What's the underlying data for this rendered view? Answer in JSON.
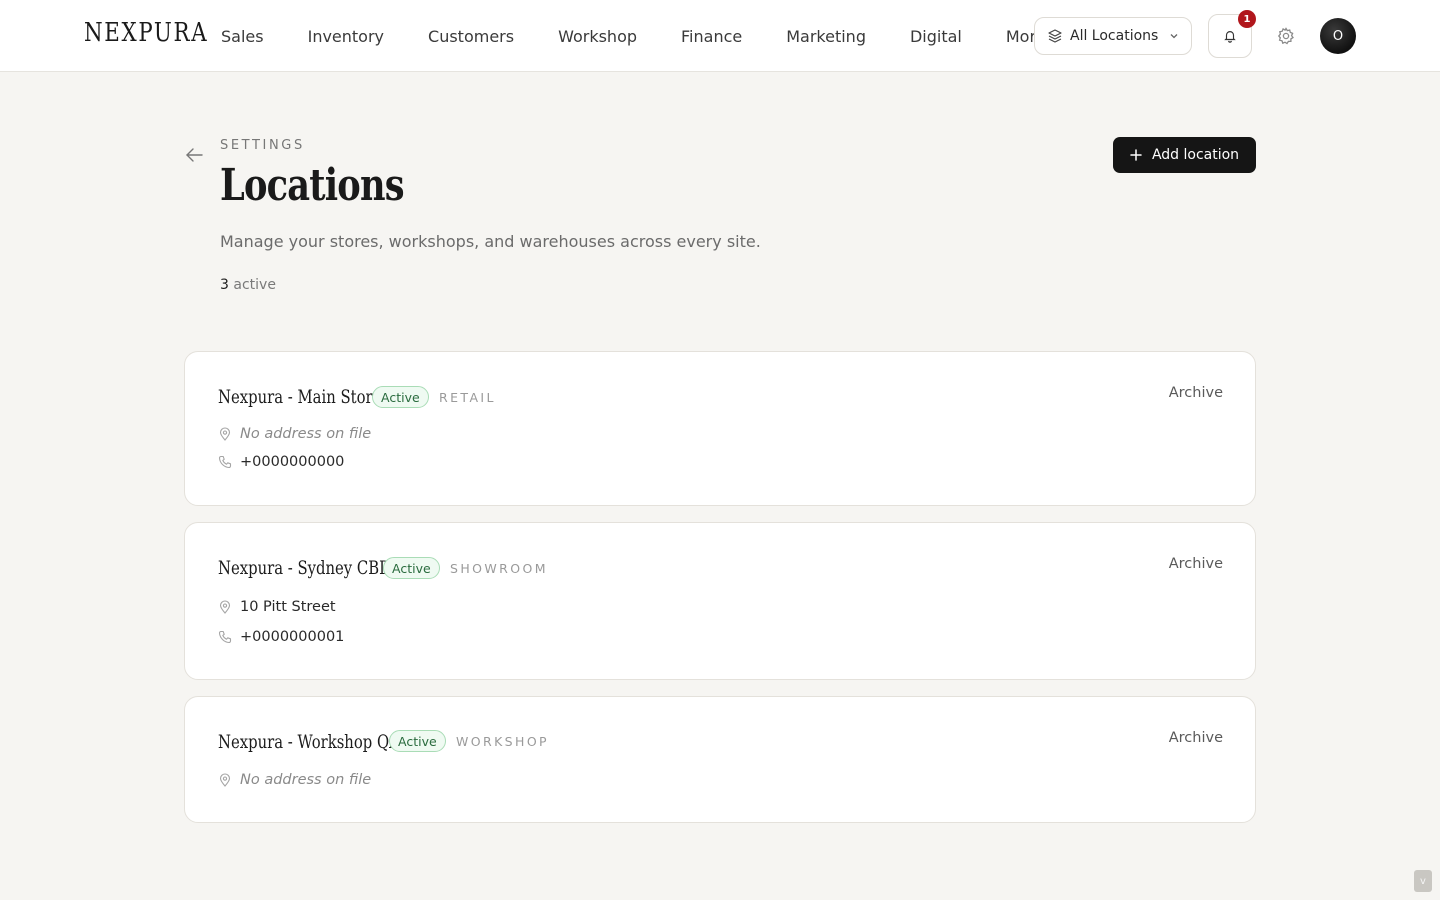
{
  "app": {
    "logo": "NEXPURA"
  },
  "nav": [
    "Sales",
    "Inventory",
    "Customers",
    "Workshop",
    "Finance",
    "Marketing",
    "Digital",
    "More"
  ],
  "location_selector": {
    "value": "All Locations"
  },
  "notifications": {
    "count": "1"
  },
  "user": {
    "initial": "O"
  },
  "header": {
    "eyebrow": "SETTINGS",
    "title": "Locations",
    "subtitle": "Manage your stores, workshops, and warehouses across every site.",
    "count_value": "3",
    "count_label": "active",
    "add_button": "Add location"
  },
  "locations": [
    {
      "name": "Nexpura - Main Store",
      "status": "Active",
      "type": "RETAIL",
      "address": "No address on file",
      "address_missing": true,
      "phone": "+0000000000",
      "archive": "Archive"
    },
    {
      "name": "Nexpura - Sydney CBD",
      "status": "Active",
      "type": "SHOWROOM",
      "address": "10 Pitt Street",
      "address_missing": false,
      "phone": "+0000000001",
      "archive": "Archive"
    },
    {
      "name": "Nexpura - Workshop QA",
      "status": "Active",
      "type": "WORKSHOP",
      "address": "No address on file",
      "address_missing": true,
      "phone": "",
      "archive": "Archive"
    }
  ],
  "corner_tab": "v",
  "colors": {
    "accent": "#151515",
    "status_green": "#2a6b3e",
    "badge_red": "#b1161c",
    "background": "#f6f5f2"
  }
}
